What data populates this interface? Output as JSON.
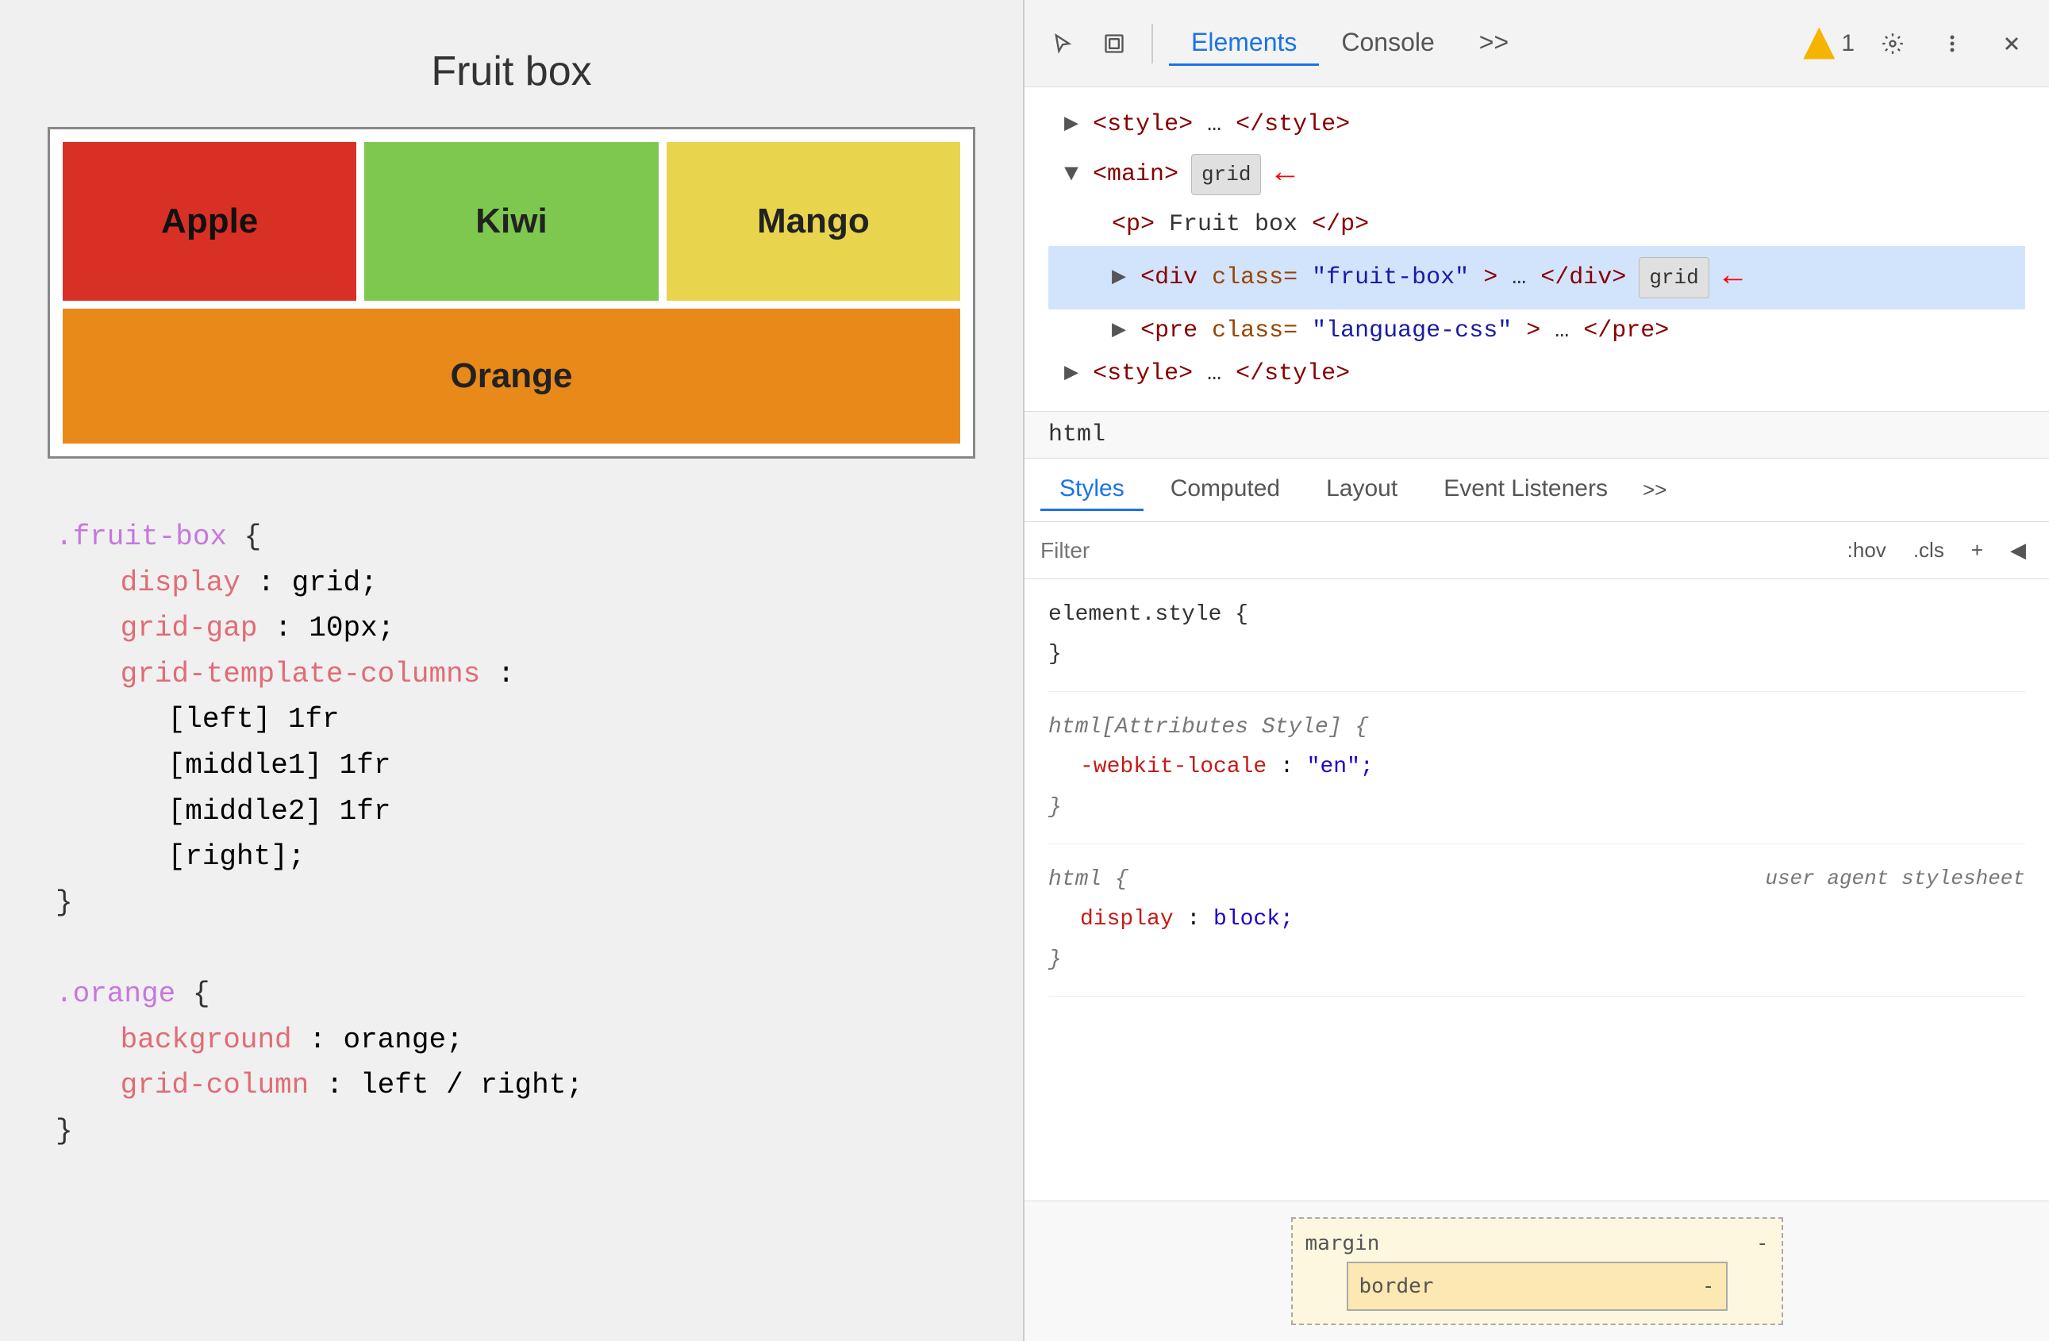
{
  "browser": {
    "left_panel": {
      "title": "Fruit box",
      "fruits": [
        {
          "name": "Apple",
          "class": "fruit-apple"
        },
        {
          "name": "Kiwi",
          "class": "fruit-kiwi"
        },
        {
          "name": "Mango",
          "class": "fruit-mango"
        },
        {
          "name": "Orange",
          "class": "fruit-orange"
        }
      ],
      "code_blocks": [
        {
          "selector": ".fruit-box",
          "properties": [
            {
              "name": "display",
              "value": "grid;"
            },
            {
              "name": "grid-gap",
              "value": "10px;"
            },
            {
              "name": "grid-template-columns",
              "value": ""
            },
            {
              "indent_value": "[left] 1fr"
            },
            {
              "indent_value": "[middle1] 1fr"
            },
            {
              "indent_value": "[middle2] 1fr"
            },
            {
              "indent_value": "[right];"
            }
          ]
        },
        {
          "selector": ".orange",
          "properties": [
            {
              "name": "background",
              "value": "orange;"
            },
            {
              "name": "grid-column",
              "value": "left / right;"
            }
          ]
        }
      ]
    },
    "devtools": {
      "toolbar": {
        "tabs": [
          "Elements",
          "Console"
        ],
        "active_tab": "Elements",
        "warning_count": "1",
        "more_label": ">>"
      },
      "dom_tree": {
        "lines": [
          {
            "indent": 0,
            "content": "▶ <style>…</style>"
          },
          {
            "indent": 0,
            "content": "▼ <main>",
            "badge": "grid",
            "arrow": true
          },
          {
            "indent": 1,
            "content": "<p>Fruit box</p>"
          },
          {
            "indent": 1,
            "content": "▶ <div class=\"fruit-box\">…</div>",
            "badge": "grid",
            "arrow": true,
            "selected": true
          },
          {
            "indent": 1,
            "content": "▶ <pre class=\"language-css\">…</pre>"
          },
          {
            "indent": 0,
            "content": "▶ <style>…</style>"
          }
        ]
      },
      "breadcrumb": "html",
      "styles_tabs": {
        "tabs": [
          "Styles",
          "Computed",
          "Layout",
          "Event Listeners"
        ],
        "active_tab": "Styles",
        "more": ">>"
      },
      "filter": {
        "placeholder": "Filter",
        "buttons": [
          ":hov",
          ".cls",
          "+",
          "◀"
        ]
      },
      "style_blocks": [
        {
          "selector": "element.style {",
          "closing": "}",
          "properties": []
        },
        {
          "selector": "html[Attributes Style] {",
          "closing": "}",
          "properties": [
            {
              "name": "-webkit-locale",
              "value": "\"en\";"
            }
          ]
        },
        {
          "selector": "html {",
          "source": "user agent stylesheet",
          "closing": "}",
          "properties": [
            {
              "name": "display",
              "value": "block;"
            }
          ]
        }
      ],
      "box_model": {
        "margin_label": "margin",
        "margin_value": "-",
        "border_label": "border",
        "border_value": "-"
      }
    }
  }
}
